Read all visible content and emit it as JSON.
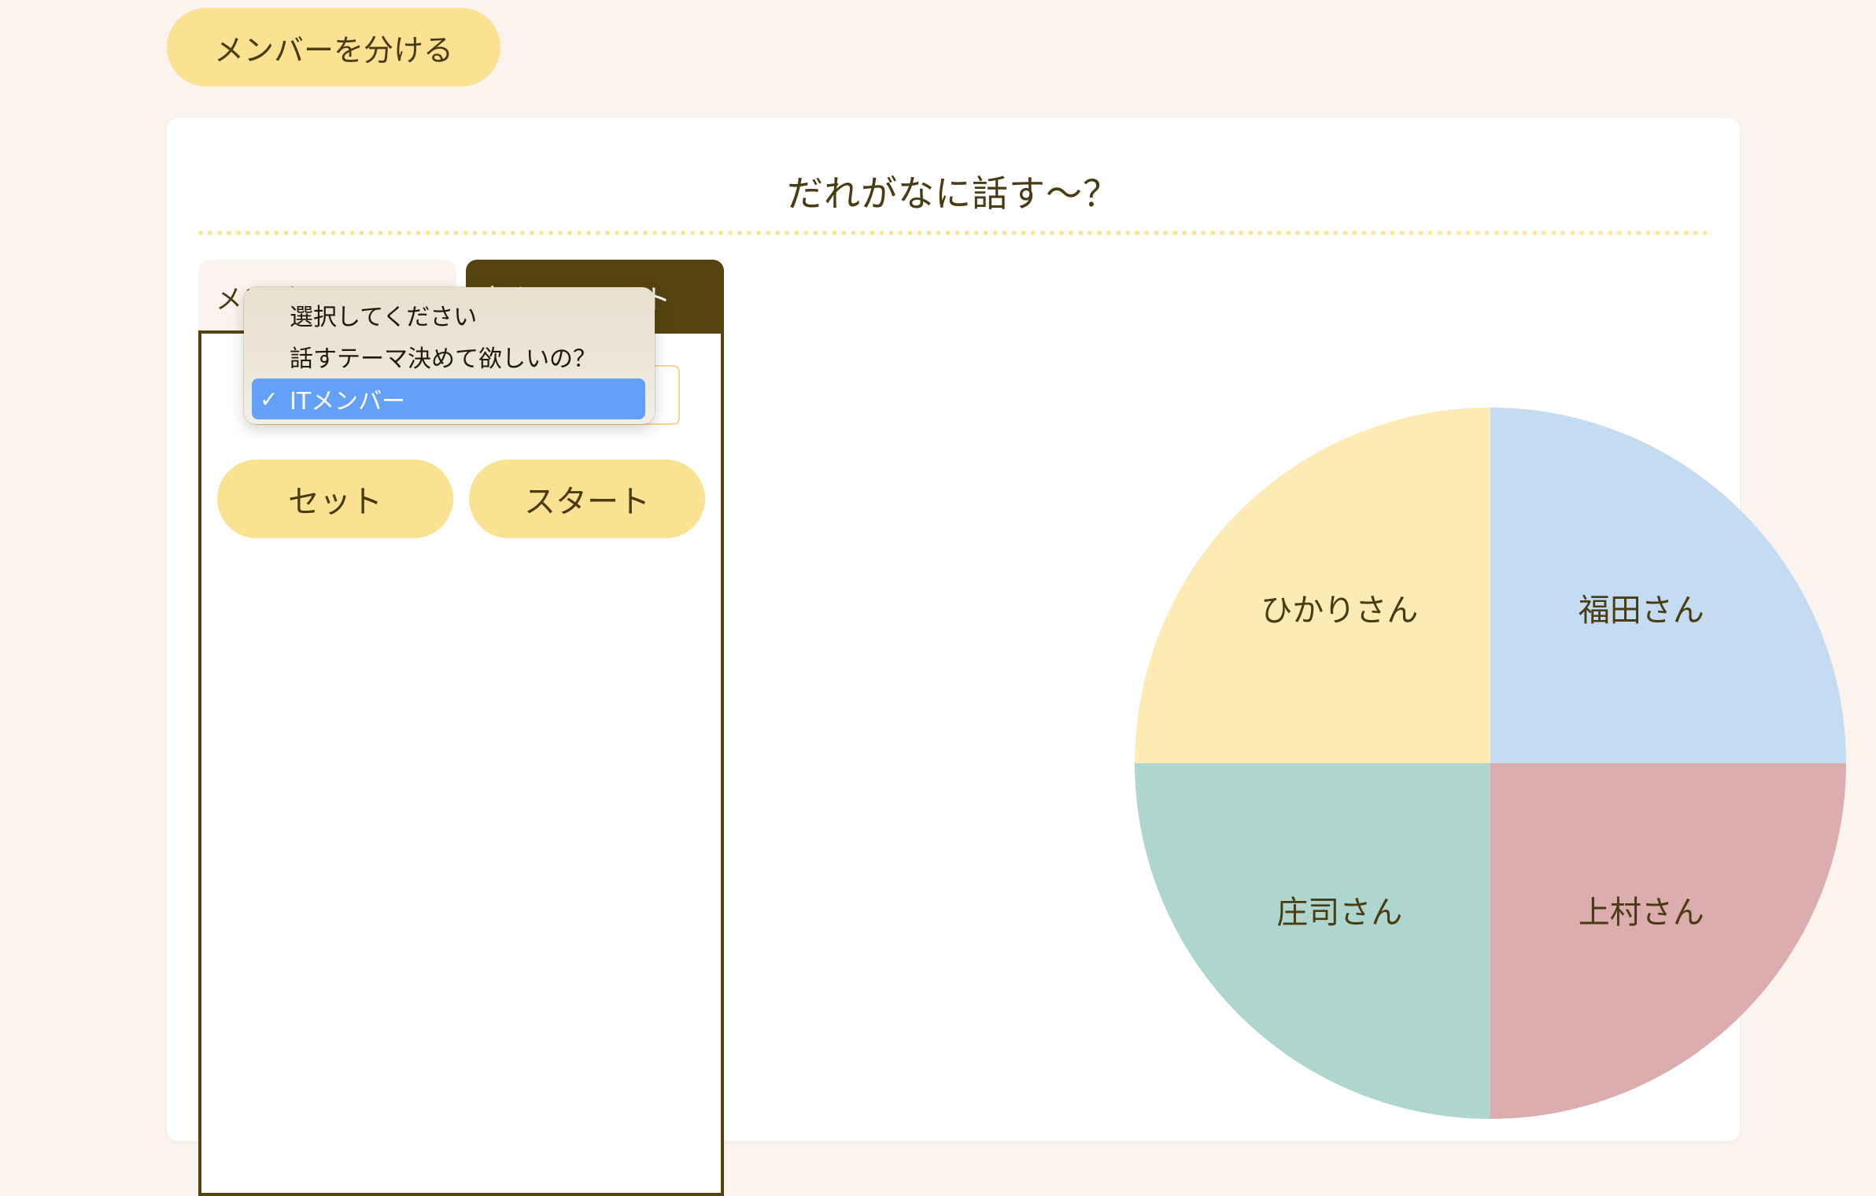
{
  "header": {
    "split_members_label": "メンバーを分ける"
  },
  "card": {
    "title": "だれがなに話す～？"
  },
  "tabs": [
    {
      "label": "メンバールーレット"
    },
    {
      "label": "急なルーレット"
    }
  ],
  "panel": {
    "set_label": "セット",
    "start_label": "スタート"
  },
  "dropdown": {
    "options": [
      {
        "label": "選択してください",
        "selected": false
      },
      {
        "label": "話すテーマ決めて欲しいの？",
        "selected": false
      },
      {
        "label": "ITメンバー",
        "selected": true
      }
    ],
    "check_glyph": "✓"
  },
  "chart_data": {
    "type": "pie",
    "slices": [
      {
        "label": "福田さん",
        "value": 1,
        "color": "#c3dcf1"
      },
      {
        "label": "上村さん",
        "value": 1,
        "color": "#dcadaf"
      },
      {
        "label": "庄司さん",
        "value": 1,
        "color": "#aed6ce"
      },
      {
        "label": "ひかりさん",
        "value": 1,
        "color": "#fdebb3"
      }
    ]
  }
}
